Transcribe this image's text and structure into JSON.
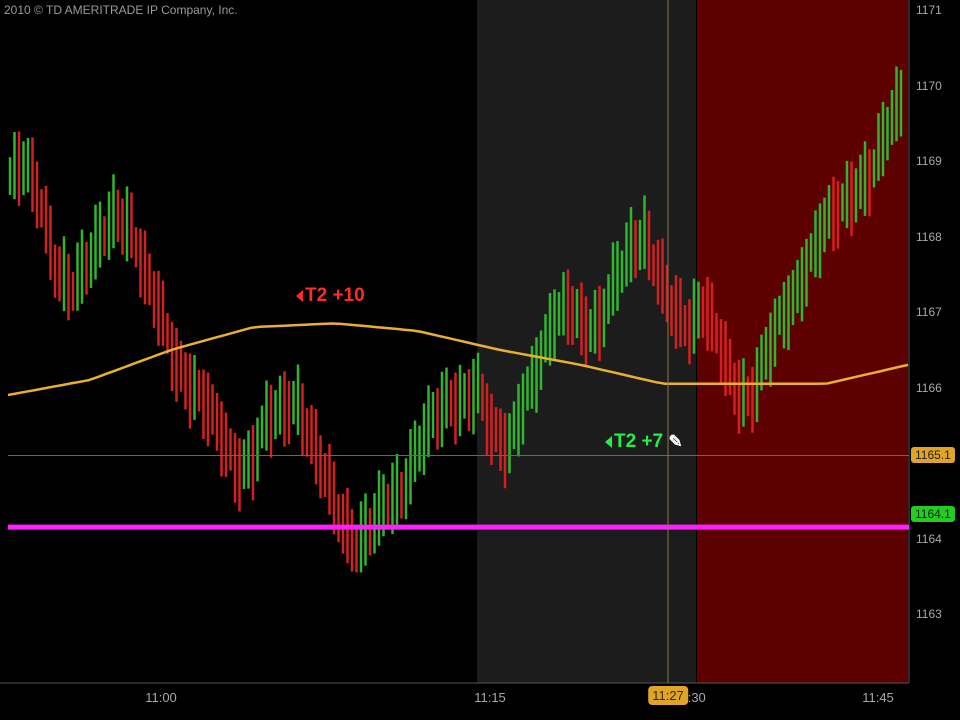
{
  "copyright": "2010 © TD AMERITRADE IP Company, Inc.",
  "chart_data": {
    "type": "bar",
    "subtype": "ohlc-price-bars",
    "ylim": [
      1162.7,
      1171.1
    ],
    "y_ticks": [
      "1171",
      "1170",
      "1169",
      "1168",
      "1167",
      "1166",
      "1164",
      "1163"
    ],
    "x_ticks": [
      "11:00",
      "11:15",
      "11:30",
      "11:45"
    ],
    "bar_mid_prices": [
      1168.8,
      1169,
      1168.5,
      1167.6,
      1167.3,
      1167.6,
      1168,
      1168.3,
      1168.1,
      1167.5,
      1167,
      1166.3,
      1166,
      1165.8,
      1165.4,
      1164.9,
      1165,
      1165.6,
      1165.7,
      1165.8,
      1165.3,
      1164.8,
      1164.2,
      1163.9,
      1164.2,
      1164.5,
      1164.6,
      1165.2,
      1165.6,
      1165.8,
      1165.8,
      1166,
      1165.4,
      1165.2,
      1165.8,
      1166.3,
      1166.9,
      1167.1,
      1166.8,
      1166.8,
      1167.4,
      1167.8,
      1168,
      1167.5,
      1167,
      1166.8,
      1167.1,
      1166.6,
      1166,
      1165.8,
      1166.4,
      1166.9,
      1167.2,
      1167.7,
      1168.2,
      1168.4,
      1168.6,
      1168.8,
      1169.4,
      1169.8
    ],
    "moving_average": [
      1165.9,
      1166.1,
      1166.5,
      1166.8,
      1166.85,
      1166.75,
      1166.5,
      1166.3,
      1166.05,
      1166.05,
      1166.05,
      1166.3
    ],
    "magenta_level": 1164.15,
    "crosshair_price": 1165.1,
    "crosshair_time": "11:27",
    "price_badge": "1165.1",
    "level_badge": "1164.1",
    "annotations": [
      {
        "text": "T2 +10",
        "color": "#ff2a2a"
      },
      {
        "text": "T2 +7",
        "color": "#22ee44"
      }
    ],
    "colors": {
      "up": "#2fb52f",
      "down": "#d42020",
      "ma": "#e8b030",
      "level": "#ff20ff",
      "shade": "#1c1c1c",
      "red_zone": "#5c0000"
    }
  }
}
